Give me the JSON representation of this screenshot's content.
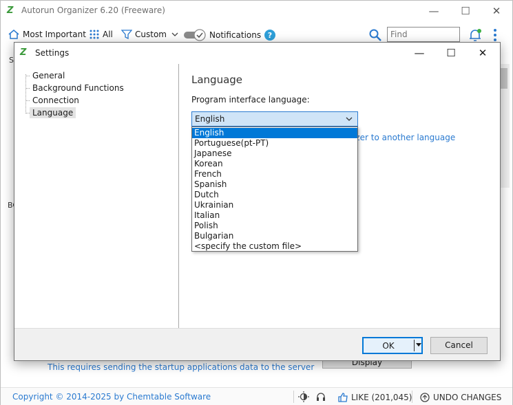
{
  "app": {
    "title": "Autorun Organizer 6.20 (Freeware)",
    "logo_text": "Z"
  },
  "toolbar": {
    "most_important": "Most Important",
    "all": "All",
    "custom": "Custom",
    "notifications": "Notifications",
    "find_placeholder": "Find"
  },
  "background": {
    "hint": "This requires sending the startup applications data to the server",
    "display_button": "Display",
    "partial_sidebar_text": "St",
    "partial_tab_text": "BC"
  },
  "statusbar": {
    "copyright": "Copyright © 2014-2025 by Chemtable Software",
    "like": "LIKE (201,045)",
    "undo": "UNDO CHANGES"
  },
  "dialog": {
    "title": "Settings",
    "nav": [
      "General",
      "Background Functions",
      "Connection",
      "Language"
    ],
    "selected_nav": "Language",
    "section_title": "Language",
    "field_label": "Program interface language:",
    "selected_language": "English",
    "translate_link": "izer to another language",
    "languages": [
      "English",
      "Portuguese(pt-PT)",
      "Japanese",
      "Korean",
      "French",
      "Spanish",
      "Dutch",
      "Ukrainian",
      "Italian",
      "Polish",
      "Bulgarian",
      "<specify the custom file>"
    ],
    "ok_label": "OK",
    "cancel_label": "Cancel"
  },
  "colors": {
    "accent": "#0078d7",
    "link": "#2a7ad0",
    "logo_green": "#3c9a3c"
  }
}
